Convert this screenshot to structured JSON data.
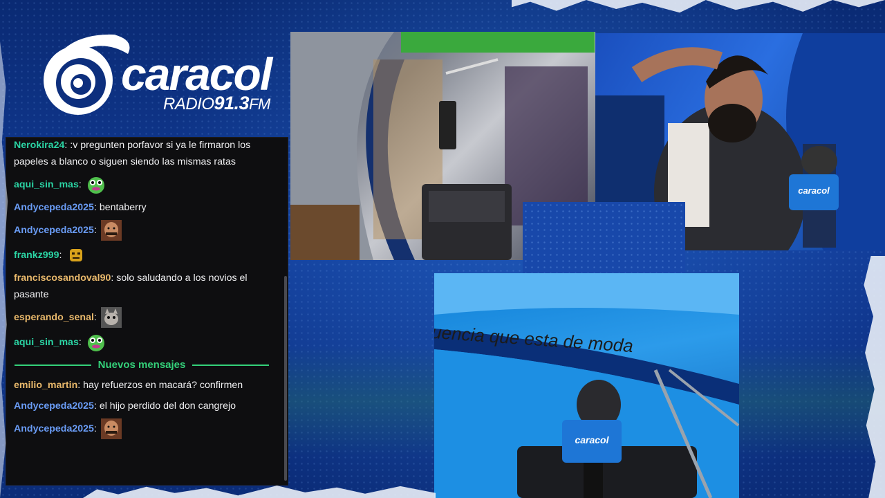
{
  "logo": {
    "wordmark": "caracol",
    "radio": "RADIO",
    "frequency": "91.3",
    "band": "FM",
    "color": "#ffffff"
  },
  "chat": {
    "messages_before": [
      {
        "user": "Nerokira24",
        "color": "#2bd4a4",
        "text": ":v pregunten porfavor si ya le firmaron los papeles a blanco o siguen siendo las mismas ratas"
      },
      {
        "user": "aqui_sin_mas",
        "color": "#2bd4a4",
        "text": "",
        "emote": "pepe-emote"
      },
      {
        "user": "Andycepeda2025",
        "color": "#6a9cf5",
        "text": "bentaberry"
      },
      {
        "user": "Andycepeda2025",
        "color": "#6a9cf5",
        "text": "",
        "emote": "face-emote"
      },
      {
        "user": "frankz999",
        "color": "#2bd4a4",
        "text": "",
        "emote": "angry-face-emote"
      },
      {
        "user": "franciscosandoval90",
        "color": "#e8b86b",
        "text": "solo saludando a los novios el pasante"
      },
      {
        "user": "esperando_senal",
        "color": "#e8b86b",
        "text": "",
        "emote": "cat-emote"
      },
      {
        "user": "aqui_sin_mas",
        "color": "#2bd4a4",
        "text": "",
        "emote": "pepe-emote"
      }
    ],
    "divider_label": "Nuevos mensajes",
    "messages_after": [
      {
        "user": "emilio_martin",
        "color": "#e8b86b",
        "text": "hay refuerzos en macará? confirmen"
      },
      {
        "user": "Andycepeda2025",
        "color": "#6a9cf5",
        "text": "el hijo perdido del don cangrejo"
      },
      {
        "user": "Andycepeda2025",
        "color": "#6a9cf5",
        "text": "",
        "emote": "face-emote"
      }
    ]
  },
  "studio": {
    "wall_text": "uencia que esta de moda",
    "mic_badge": "caracol"
  }
}
